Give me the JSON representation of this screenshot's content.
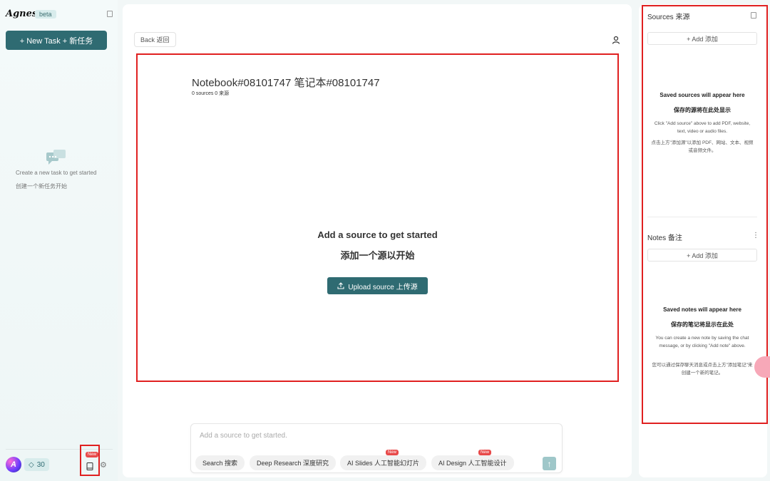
{
  "sidebar": {
    "logo": "Agnes",
    "badge": "beta",
    "new_task": "+ New Task  + 新任务",
    "empty_en": "Create a new task to get started",
    "empty_zh": "创建一个新任务开始",
    "credits": "30",
    "new_badge": "New"
  },
  "main": {
    "back": "Back  返回",
    "title": "Notebook#08101747  笔记本#08101747",
    "subtitle": "0 sources  0 来源",
    "empty_en": "Add a source to get started",
    "empty_zh": "添加一个源以开始",
    "upload": "Upload source  上传源",
    "composer_placeholder": "Add a source to get started.",
    "chips": [
      {
        "label": "Search  搜索",
        "new": ""
      },
      {
        "label": "Deep Research  深度研究",
        "new": ""
      },
      {
        "label": "AI Slides  人工智能幻灯片",
        "new": "New"
      },
      {
        "label": "AI Design  人工智能设计",
        "new": "New"
      }
    ]
  },
  "right": {
    "sources_title": "Sources  来源",
    "sources_add": "+ Add  添加",
    "sources_head_en": "Saved sources will appear here",
    "sources_head_zh": "保存的源将在此处显示",
    "sources_desc_en": "Click \"Add source\" above to add PDF, website, text, video or audio files.",
    "sources_desc_zh": "点击上方\"添加源\"以添加 PDF、网站、文本、视频或音频文件。",
    "notes_title": "Notes  备注",
    "notes_add": "+ Add  添加",
    "notes_head_en": "Saved notes will appear here",
    "notes_head_zh": "保存的笔记将显示在此处",
    "notes_desc_en": "You can create a new note by saving the chat message, or by clicking \"Add note\" above.",
    "notes_desc_zh": "您可以通过保存聊天消息或点击上方\"添加笔记\"来创建一个新的笔记。"
  },
  "colors": {
    "accent": "#2f6b72",
    "highlight": "#e02020",
    "badge_red": "#e84a4a"
  }
}
